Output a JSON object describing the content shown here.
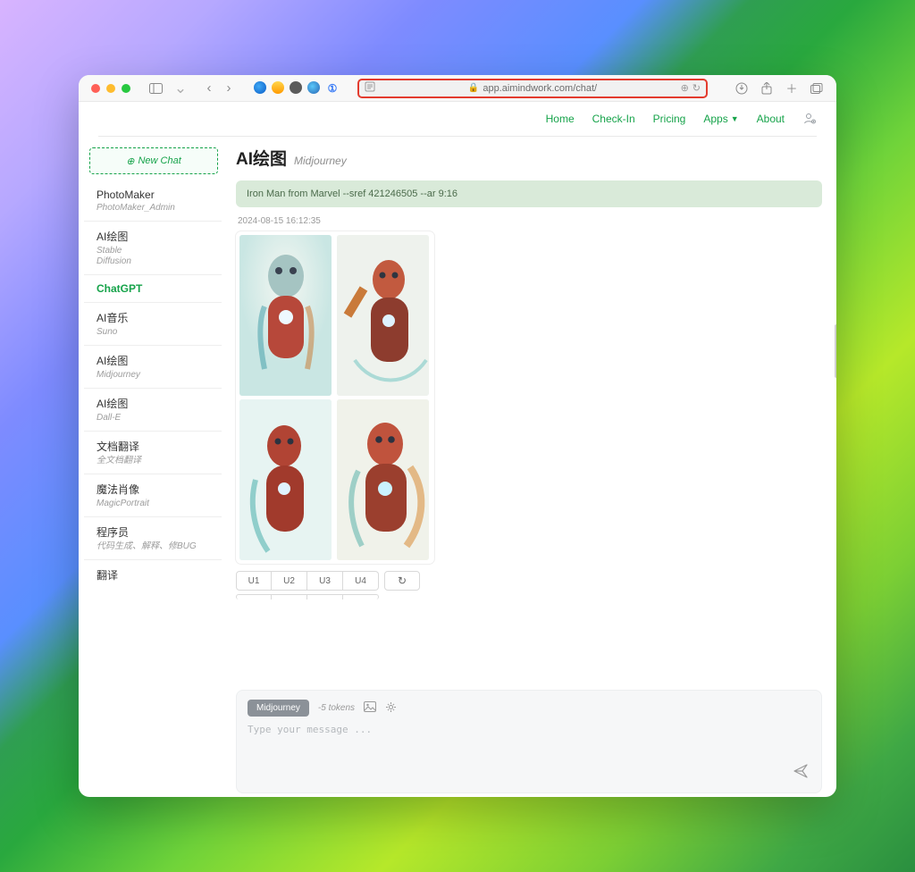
{
  "browser": {
    "url": "app.aimindwork.com/chat/"
  },
  "topnav": {
    "home": "Home",
    "checkin": "Check-In",
    "pricing": "Pricing",
    "apps": "Apps",
    "about": "About"
  },
  "sidebar": {
    "newchat": "New Chat",
    "items": [
      {
        "title": "PhotoMaker",
        "sub": "PhotoMaker_Admin"
      },
      {
        "title": "AI绘图",
        "sub": "Stable\nDiffusion"
      },
      {
        "title": "ChatGPT",
        "sub": ""
      },
      {
        "title": "AI音乐",
        "sub": "Suno"
      },
      {
        "title": "AI绘图",
        "sub": "Midjourney"
      },
      {
        "title": "AI绘图",
        "sub": "Dall-E"
      },
      {
        "title": "文档翻译",
        "sub": "全文档翻译"
      },
      {
        "title": "魔法肖像",
        "sub": "MagicPortrait"
      },
      {
        "title": "程序员",
        "sub": "代码生成、解释、修BUG"
      },
      {
        "title": "翻译",
        "sub": ""
      }
    ],
    "active_index": 2
  },
  "page": {
    "title": "AI绘图",
    "subtitle": "Midjourney"
  },
  "prompt": "Iron Man from Marvel --sref 421246505 --ar 9:16",
  "timestamp": "2024-08-15 16:12:35",
  "variants": {
    "u1": "U1",
    "u2": "U2",
    "u3": "U3",
    "u4": "U4"
  },
  "composer": {
    "model": "Midjourney",
    "tokens": "-5 tokens",
    "placeholder": "Type your message ..."
  }
}
